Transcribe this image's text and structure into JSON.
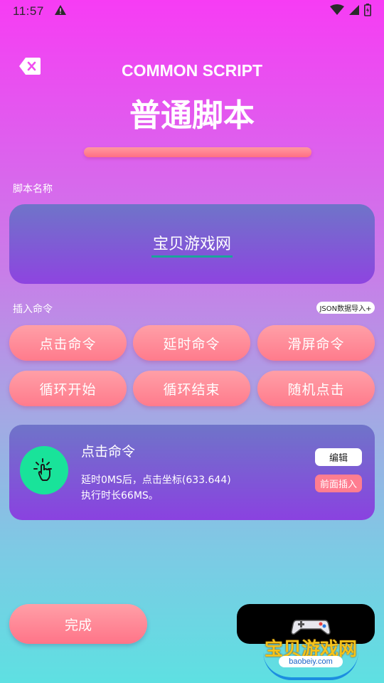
{
  "status_bar": {
    "time": "11:57"
  },
  "header": {
    "title_en": "COMMON SCRIPT",
    "title_cn": "普通脚本"
  },
  "script_name": {
    "label": "脚本名称",
    "value": "宝贝游戏网"
  },
  "insert": {
    "label": "插入命令",
    "json_import": "JSON数据导入+",
    "buttons": [
      "点击命令",
      "延时命令",
      "滑屏命令",
      "循环开始",
      "循环结束",
      "随机点击"
    ]
  },
  "command_card": {
    "title": "点击命令",
    "detail_line1": "延时0MS后，点击坐标(633.644)",
    "detail_line2": "执行时长66MS。",
    "edit": "编辑",
    "insert_before": "前面插入"
  },
  "footer": {
    "done": "完成"
  },
  "watermark": {
    "text": "宝贝游戏网",
    "url": "baobeiy.com"
  },
  "colors": {
    "accent_pink": "#ff7b8c",
    "card_purple": "#8a42e0",
    "icon_green": "#19e39a"
  }
}
